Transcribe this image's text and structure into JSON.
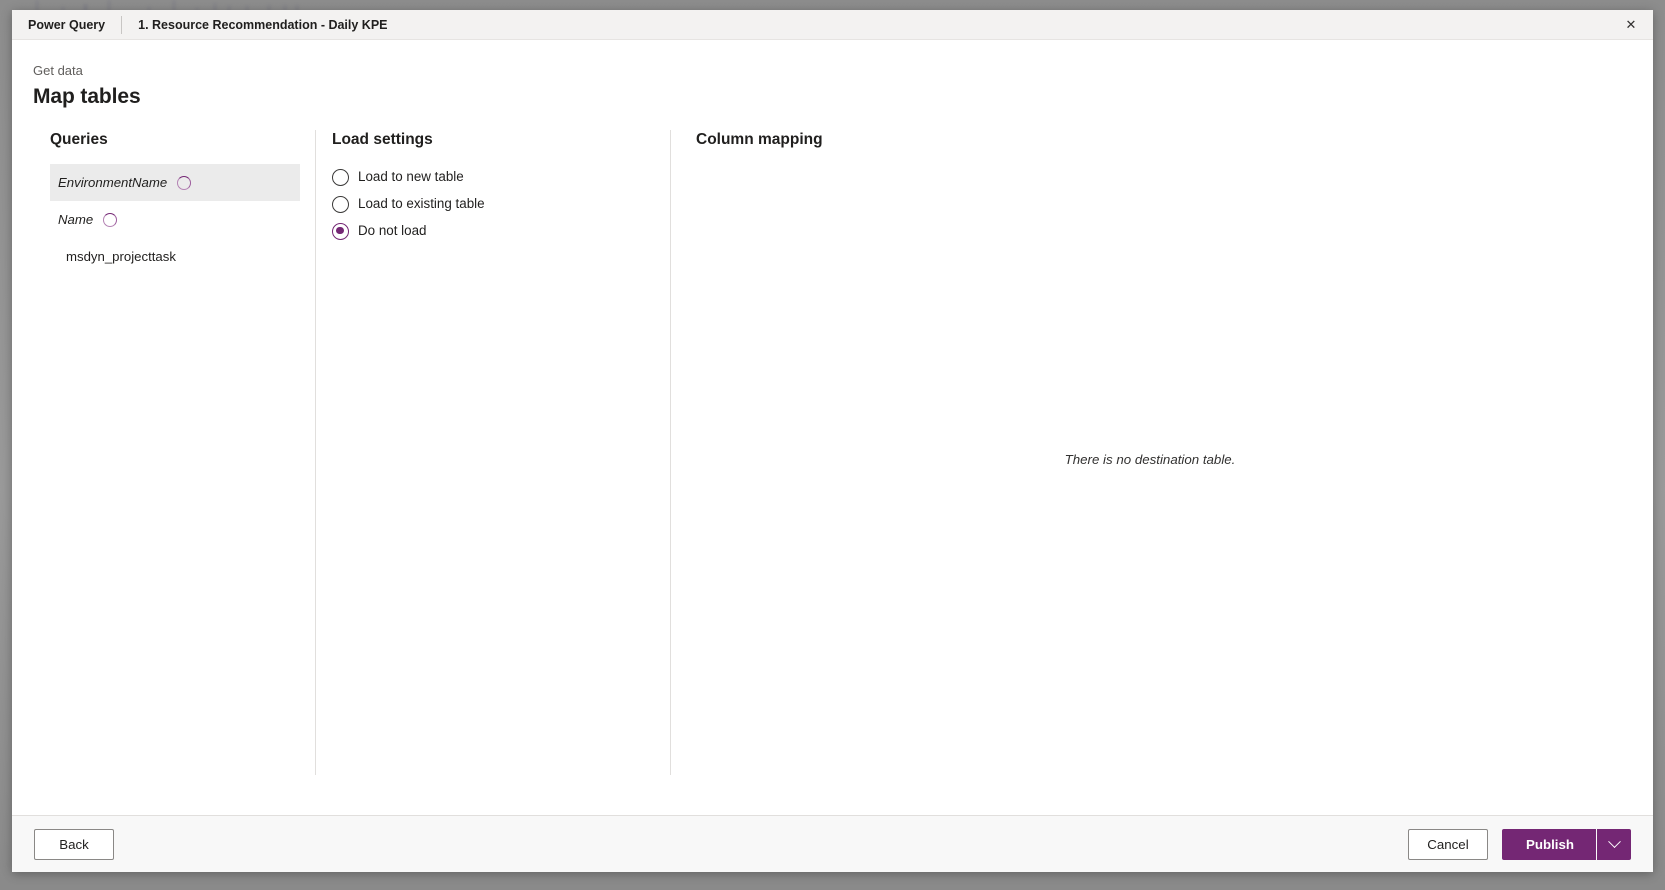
{
  "window": {
    "tab_app": "Power Query",
    "tab_document": "1. Resource Recommendation - Daily KPE",
    "close_icon": "close-icon",
    "close_glyph": "✕"
  },
  "header": {
    "eyebrow": "Get data",
    "title": "Map tables"
  },
  "queries": {
    "title": "Queries",
    "items": [
      {
        "label": "EnvironmentName",
        "italic": true,
        "loading": true,
        "selected": true
      },
      {
        "label": "Name",
        "italic": true,
        "loading": true,
        "selected": false
      },
      {
        "label": "msdyn_projecttask",
        "italic": false,
        "loading": false,
        "selected": false
      }
    ]
  },
  "load_settings": {
    "title": "Load settings",
    "options": [
      {
        "label": "Load to new table",
        "checked": false
      },
      {
        "label": "Load to existing table",
        "checked": false
      },
      {
        "label": "Do not load",
        "checked": true
      }
    ],
    "selected": "Do not load"
  },
  "column_mapping": {
    "title": "Column mapping",
    "empty_message": "There is no destination table."
  },
  "footer": {
    "back_label": "Back",
    "cancel_label": "Cancel",
    "publish_label": "Publish",
    "publish_caret_icon": "chevron-down-icon"
  },
  "colors": {
    "accent_purple": "#742774",
    "spinner_purple": "#742774",
    "chrome_gray": "#f3f2f1",
    "selected_row": "#ebebeb",
    "divider": "#e1dfdd",
    "backdrop": "#8c8c8c"
  }
}
